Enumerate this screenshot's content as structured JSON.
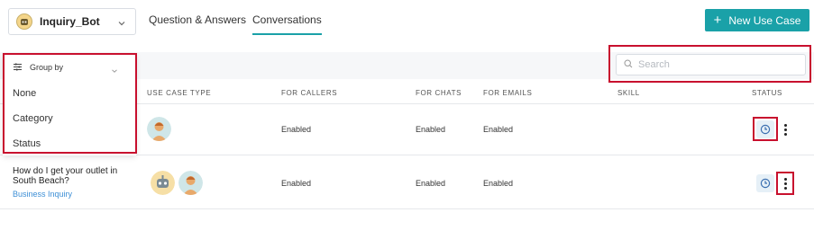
{
  "header": {
    "bot_name": "Inquiry_Bot",
    "tabs": [
      {
        "label": "Question & Answers",
        "active": false
      },
      {
        "label": "Conversations",
        "active": true
      }
    ],
    "new_use_case_label": "New Use Case"
  },
  "toolbar": {
    "group_by_label": "Group by",
    "group_by_options": [
      "None",
      "Category",
      "Status"
    ],
    "search_placeholder": "Search"
  },
  "table": {
    "columns": [
      "USE CASE TYPE",
      "FOR CALLERS",
      "FOR CHATS",
      "FOR EMAILS",
      "SKILL",
      "STATUS"
    ],
    "rows": [
      {
        "question": "",
        "category": "",
        "use_case_type_icons": [
          "agent-avatar-icon"
        ],
        "for_callers": "Enabled",
        "for_chats": "Enabled",
        "for_emails": "Enabled",
        "skill": ""
      },
      {
        "question": "How do I get your outlet in South Beach?",
        "category": "Business Inquiry",
        "use_case_type_icons": [
          "bot-avatar-icon",
          "agent-avatar-icon"
        ],
        "for_callers": "Enabled",
        "for_chats": "Enabled",
        "for_emails": "Enabled",
        "skill": ""
      }
    ]
  },
  "colors": {
    "accent": "#1aa1a8",
    "annotation": "#c8102e",
    "link": "#3d8fd6"
  }
}
